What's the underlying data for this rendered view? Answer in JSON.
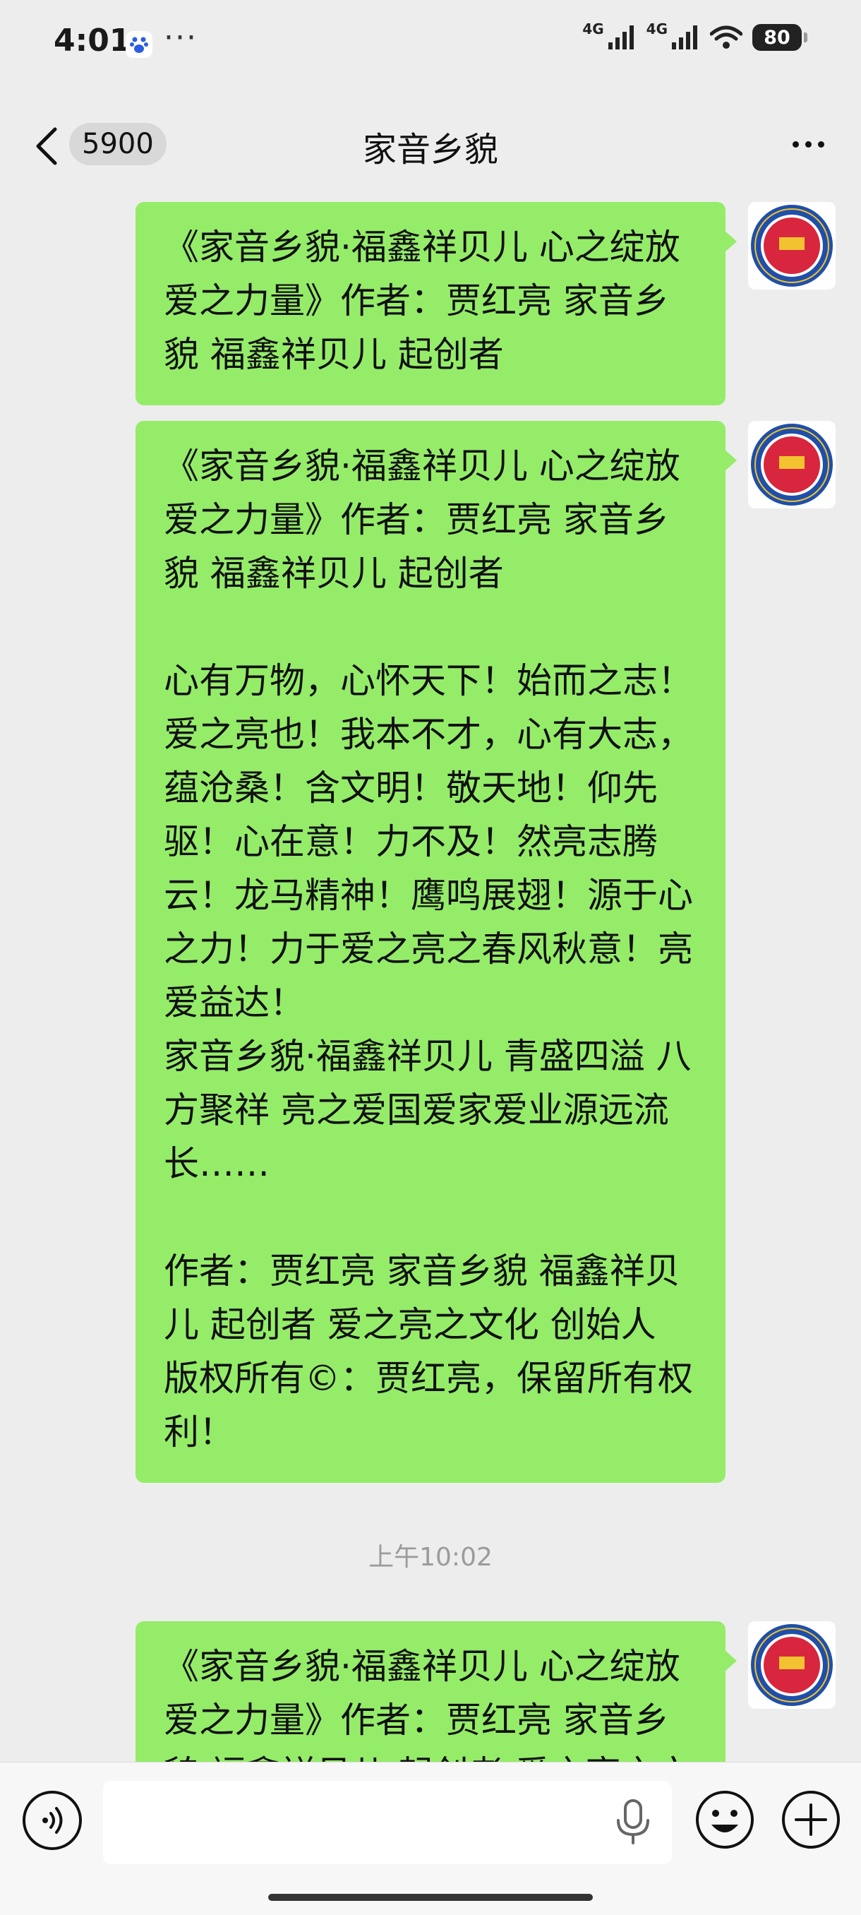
{
  "status_bar": {
    "time": "4:01",
    "more_dots": "···",
    "network_1": "4G",
    "network_2": "4G",
    "battery": "80"
  },
  "header": {
    "unread_count": "5900",
    "title": "家音乡貌"
  },
  "messages": [
    {
      "text": "《家音乡貌·福鑫祥贝儿 心之绽放 爱之力量》作者：贾红亮 家音乡貌 福鑫祥贝儿 起创者"
    },
    {
      "text": "《家音乡貌·福鑫祥贝儿 心之绽放 爱之力量》作者：贾红亮 家音乡貌 福鑫祥贝儿 起创者\n\n心有万物，心怀天下！始而之志！爱之亮也！我本不才，心有大志，蕴沧桑！含文明！敬天地！仰先驱！心在意！力不及！然亮志腾云！龙马精神！鹰鸣展翅！源于心之力！力于爱之亮之春风秋意！亮爱益达！\n家音乡貌·福鑫祥贝儿 青盛四溢 八方聚祥 亮之爱国爱家爱业源远流长……\n\n作者：贾红亮 家音乡貌 福鑫祥贝儿 起创者 爱之亮之文化 创始人 版权所有©：贾红亮，保留所有权利！"
    },
    {
      "text": "《家音乡貌·福鑫祥贝儿 心之绽放 爱之力量》作者：贾红亮 家音乡貌 福鑫祥贝儿 起创者 爱之亮之文化"
    }
  ],
  "time_divider": "上午10:02",
  "colors": {
    "bubble": "#95ec69",
    "background": "#ededed",
    "avatar_ring": "#1f4fa8",
    "avatar_center": "#d7263d"
  }
}
